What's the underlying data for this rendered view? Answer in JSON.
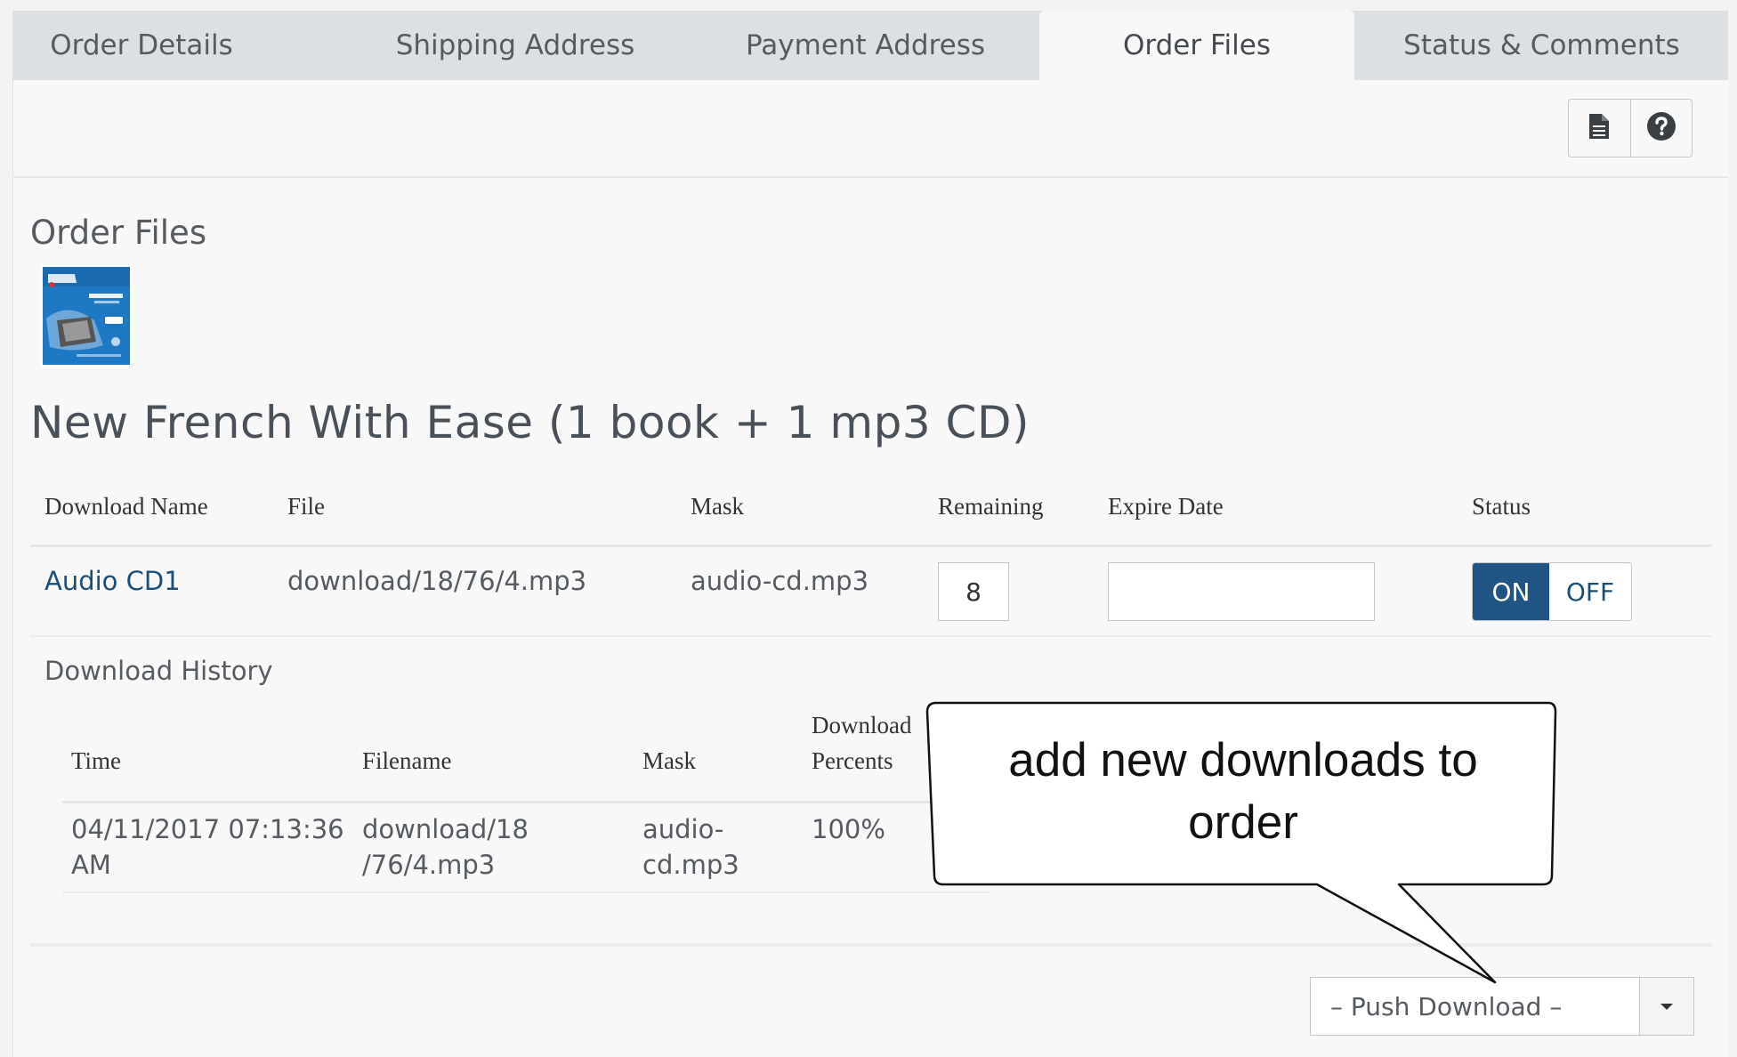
{
  "tabs": [
    {
      "label": "Order Details"
    },
    {
      "label": "Shipping Address"
    },
    {
      "label": "Payment Address"
    },
    {
      "label": "Order Files"
    },
    {
      "label": "Status & Comments"
    }
  ],
  "toolbar": {
    "file_icon": "document-icon",
    "help_icon": "question-circle-icon"
  },
  "section_title": "Order Files",
  "product": {
    "title": "New French With Ease (1 book + 1 mp3 CD)"
  },
  "downloads_table": {
    "headers": {
      "name": "Download Name",
      "file": "File",
      "mask": "Mask",
      "remaining": "Remaining",
      "expire": "Expire Date",
      "status": "Status"
    },
    "row": {
      "name": "Audio CD1",
      "file": "download/18/76/4.mp3",
      "mask": "audio-cd.mp3",
      "remaining": "8",
      "expire": "",
      "status_on": "ON",
      "status_off": "OFF"
    }
  },
  "history": {
    "title": "Download History",
    "headers": {
      "time": "Time",
      "filename": "Filename",
      "mask": "Mask",
      "percent_line1": "Download",
      "percent_line2": "Percents"
    },
    "row": {
      "time_line1": "04/11/2017 07:13:36",
      "time_line2": "AM",
      "filename_line1": "download/18",
      "filename_line2": "/76/4.mp3",
      "mask_line1": "audio-",
      "mask_line2": "cd.mp3",
      "percent": "100%"
    }
  },
  "push_download": {
    "label": "– Push Download –"
  },
  "callout": {
    "line1": "add new downloads to",
    "line2": "order"
  },
  "colors": {
    "accent": "#1f5485",
    "link": "#1d4f7b",
    "tab_bar": "#dde0e3",
    "panel": "#f8f8f8"
  }
}
